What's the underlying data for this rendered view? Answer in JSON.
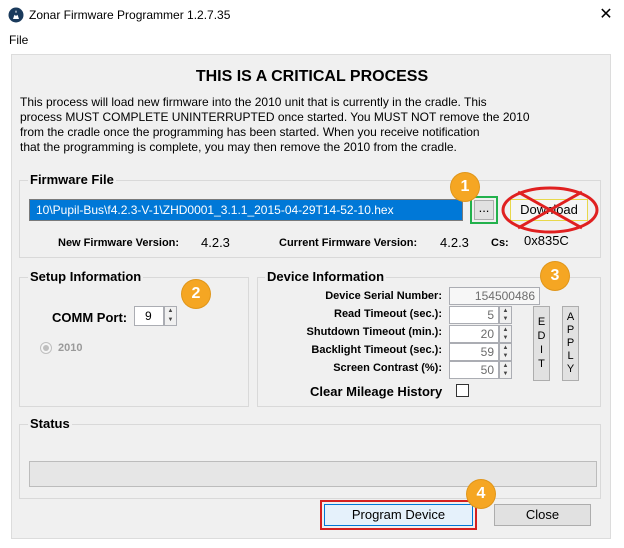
{
  "window": {
    "title": "Zonar Firmware Programmer 1.2.7.35",
    "close_glyph": "✕"
  },
  "menu": {
    "file": "File"
  },
  "header": {
    "title": "THIS IS A CRITICAL PROCESS",
    "line1": "This process will load new firmware into the 2010 unit that is currently in the cradle.  This",
    "line2": "process MUST COMPLETE UNINTERRUPTED once started.  You MUST NOT remove the 2010",
    "line3": "from the cradle once the programming has been started.  When you receive notification",
    "line4": "that the programming is complete, you may then remove the 2010 from the cradle."
  },
  "firmware": {
    "title": "Firmware File",
    "path": "10\\Pupil-Bus\\f4.2.3-V-1\\ZHD0001_3.1.1_2015-04-29T14-52-10.hex",
    "browse_label": "...",
    "download_label": "Download",
    "new_version_label": "New Firmware Version:",
    "new_version": "4.2.3",
    "current_version_label": "Current Firmware Version:",
    "current_version": "4.2.3",
    "cs_label": "Cs:",
    "cs_value": "0x835C"
  },
  "setup": {
    "title": "Setup Information",
    "comm_label": "COMM Port:",
    "comm_value": "9",
    "radio_label": "2010"
  },
  "device": {
    "title": "Device Information",
    "serial_label": "Device Serial Number:",
    "serial_value": "154500486",
    "read_label": "Read Timeout (sec.):",
    "read_value": "5",
    "shutdown_label": "Shutdown Timeout (min.):",
    "shutdown_value": "20",
    "backlight_label": "Backlight Timeout (sec.):",
    "backlight_value": "59",
    "contrast_label": "Screen Contrast (%):",
    "contrast_value": "50",
    "edit_label": "E\nD\nI\nT",
    "apply_label": "A\nP\nP\nL\nY",
    "clear_label": "Clear Mileage History"
  },
  "status": {
    "title": "Status"
  },
  "footer": {
    "program_label": "Program Device",
    "close_label": "Close"
  },
  "badges": {
    "b1": "1",
    "b2": "2",
    "b3": "3",
    "b4": "4"
  },
  "colors": {
    "accent": "#0078d7",
    "badge": "#f5a623",
    "highlight_green": "#22b14c",
    "highlight_red": "#e02020"
  }
}
